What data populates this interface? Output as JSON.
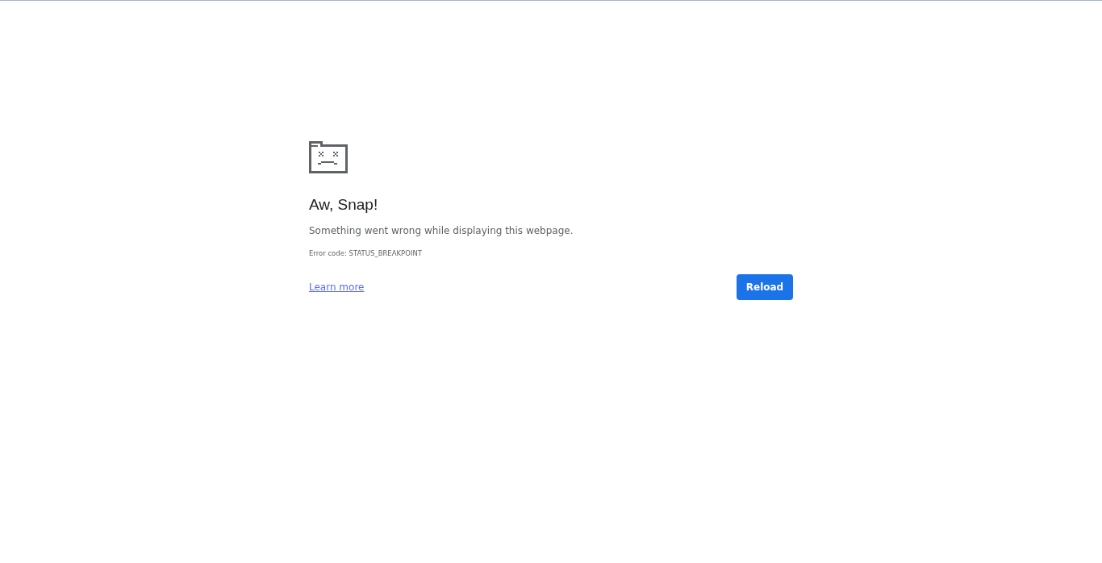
{
  "error_page": {
    "title": "Aw, Snap!",
    "message": "Something went wrong while displaying this webpage.",
    "error_code": "Error code: STATUS_BREAKPOINT",
    "link": "Learn more",
    "button": "Reload"
  }
}
